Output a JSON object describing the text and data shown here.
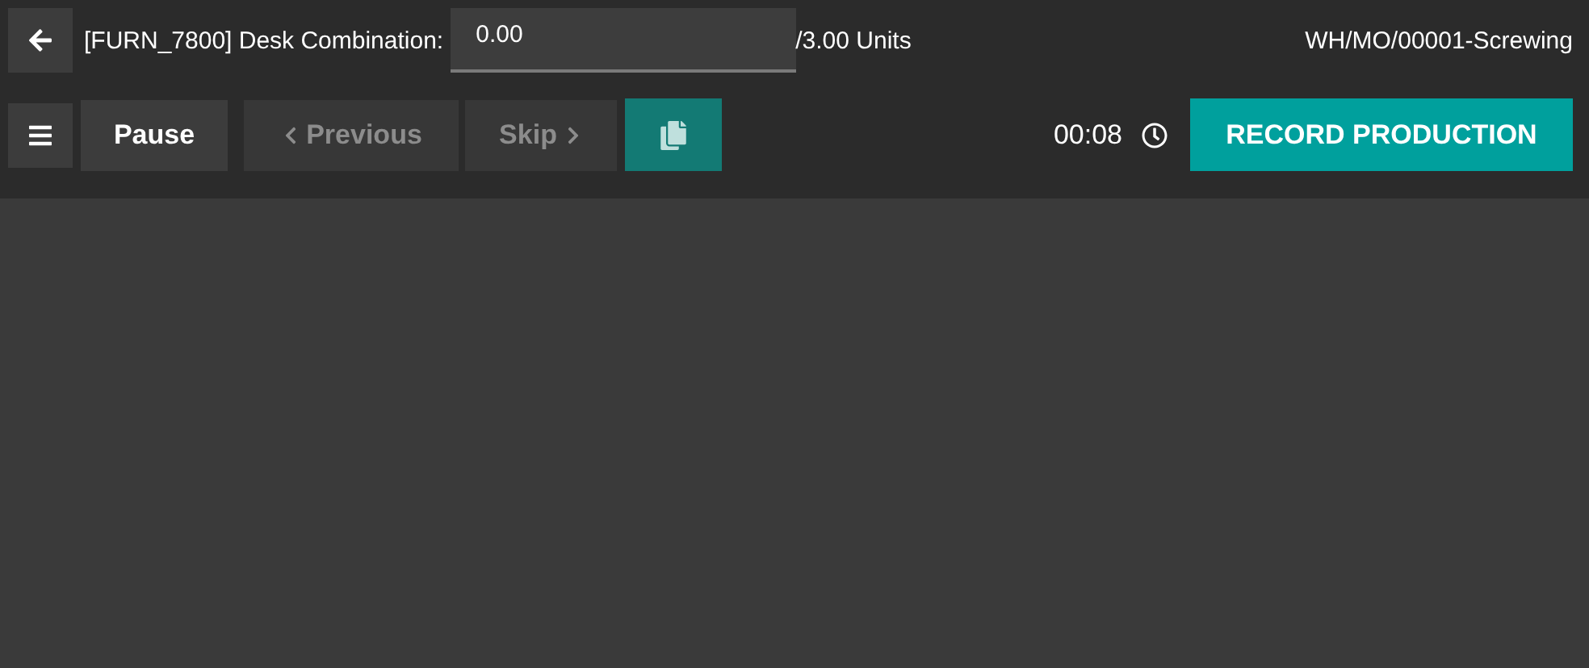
{
  "header": {
    "product_label": "[FURN_7800] Desk Combination:",
    "quantity_field": {
      "value": "0.00"
    },
    "quantity_total": "/3.00 Units",
    "work_order": "WH/MO/00001-Screwing"
  },
  "toolbar": {
    "buttons": [
      {
        "kind": "menu",
        "disabled": false
      },
      {
        "kind": "text",
        "label": "Pause",
        "disabled": false
      },
      {
        "kind": "prev",
        "label": "Previous",
        "disabled": true
      },
      {
        "kind": "next",
        "label": "Skip",
        "disabled": true
      },
      {
        "kind": "doc",
        "disabled": false
      }
    ],
    "timer": "00:08",
    "record_button": "RECORD PRODUCTION"
  }
}
